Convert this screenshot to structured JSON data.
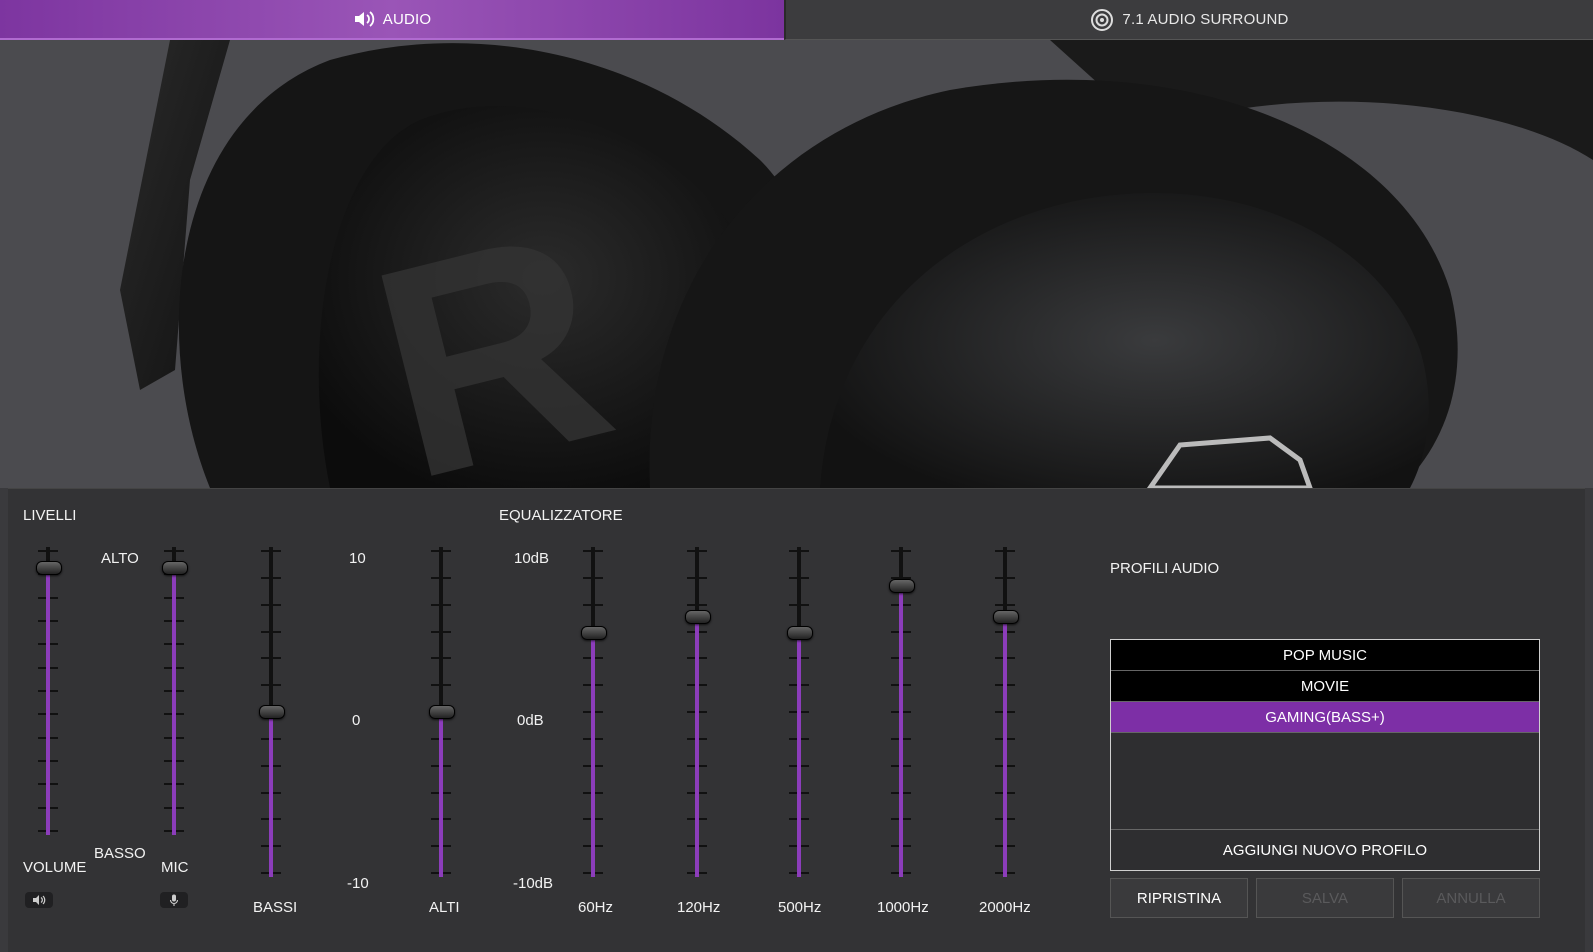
{
  "tabs": [
    {
      "label": "AUDIO",
      "icon": "speaker-icon",
      "active": true
    },
    {
      "label": "7.1 AUDIO SURROUND",
      "icon": "surround-icon",
      "active": false
    }
  ],
  "colors": {
    "accent": "#8c3dbb",
    "selected": "#7d2fa6",
    "panel": "#333335"
  },
  "levels": {
    "title": "LIVELLI",
    "high_label": "ALTO",
    "low_label": "BASSO",
    "volume": {
      "label": "VOLUME",
      "value": 0.95,
      "icon": "speaker-icon"
    },
    "mic": {
      "label": "MIC",
      "value": 0.95,
      "icon": "microphone-icon"
    }
  },
  "tone": {
    "scale_top": "10",
    "scale_mid": "0",
    "scale_bottom": "-10",
    "bass": {
      "label": "BASSI",
      "value": 0
    },
    "treble": {
      "label": "ALTI",
      "value": 0
    }
  },
  "equalizer": {
    "title": "EQUALIZZATORE",
    "scale_top": "10dB",
    "scale_mid": "0dB",
    "scale_bottom": "-10dB",
    "bands": [
      {
        "label": "60Hz",
        "value": 5
      },
      {
        "label": "120Hz",
        "value": 6
      },
      {
        "label": "500Hz",
        "value": 5
      },
      {
        "label": "1000Hz",
        "value": 8
      },
      {
        "label": "2000Hz",
        "value": 6
      }
    ]
  },
  "profiles": {
    "title": "PROFILI AUDIO",
    "items": [
      "POP MUSIC",
      "MOVIE",
      "GAMING(BASS+)"
    ],
    "selected": "GAMING(BASS+)",
    "add_label": "AGGIUNGI NUOVO PROFILO"
  },
  "buttons": {
    "reset": "RIPRISTINA",
    "save": "SALVA",
    "cancel": "ANNULLA"
  }
}
